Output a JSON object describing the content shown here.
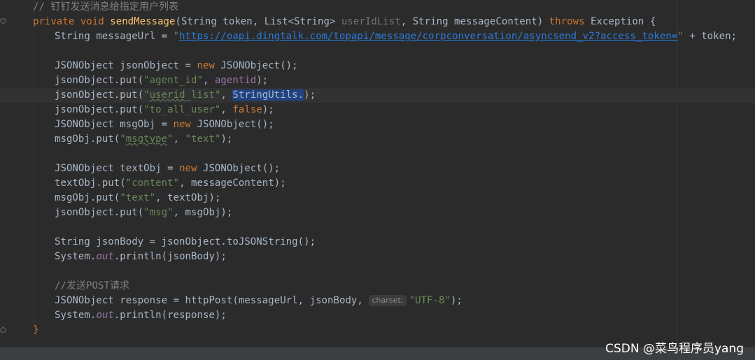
{
  "code": {
    "comment_header": "// 钉钉发送消息给指定用户列表",
    "sig": {
      "private": "private",
      "void": "void",
      "name": "sendMessage",
      "p1_type": "(String token, List<String> ",
      "p2": "userIdList",
      "p3": ", String messageContent) ",
      "throws": "throws",
      "exc": " Exception {"
    },
    "l2": {
      "a": "String messageUrl = ",
      "q1": "\"",
      "url": "https://oapi.dingtalk.com/topapi/message/corpconversation/asyncsend_v2?access_token=",
      "q2": "\"",
      "b": " + token;"
    },
    "l4": {
      "a": "JSONObject jsonObject = ",
      "new": "new",
      "b": " JSONObject();"
    },
    "l5": {
      "a": "jsonObject.put(",
      "s": "\"agent_id\"",
      "c": ", ",
      "f": "agentid",
      "b": ");"
    },
    "l6": {
      "a": "jsonObject.put(",
      "s1": "\"",
      "s2": "userid",
      "s3": "_list\"",
      "c": ", ",
      "sel": "StringUtils.",
      "b": ");"
    },
    "l7": {
      "a": "jsonObject.put(",
      "s": "\"to_all_user\"",
      "c": ", ",
      "k": "false",
      "b": ");"
    },
    "l8": {
      "a": "JSONObject msgObj = ",
      "new": "new",
      "b": " JSONObject();"
    },
    "l9": {
      "a": "msgObj.put(",
      "s1": "\"",
      "s2": "msgtype",
      "s3": "\"",
      "c": ", ",
      "s4": "\"text\"",
      "b": ");"
    },
    "l11": {
      "a": "JSONObject textObj = ",
      "new": "new",
      "b": " JSONObject();"
    },
    "l12": {
      "a": "textObj.put(",
      "s": "\"content\"",
      "b": ", messageContent);"
    },
    "l13": {
      "a": "msgObj.put(",
      "s": "\"text\"",
      "b": ", textObj);"
    },
    "l14": {
      "a": "jsonObject.put(",
      "s": "\"msg\"",
      "b": ", msgObj);"
    },
    "l16": {
      "a": "String jsonBody = jsonObject.toJSONString();"
    },
    "l17": {
      "a": "System.",
      "out": "out",
      "b": ".println(jsonBody);"
    },
    "l19": {
      "c": "//发送POST请求"
    },
    "l20": {
      "a": "JSONObject response = httpPost(messageUrl, jsonBody, ",
      "hint": "charset:",
      "s": "\"UTF-8\"",
      "b": ");"
    },
    "l21": {
      "a": "System.",
      "out": "out",
      "b": ".println(response);"
    },
    "close": "}"
  },
  "watermark": "CSDN @菜鸟程序员yang"
}
